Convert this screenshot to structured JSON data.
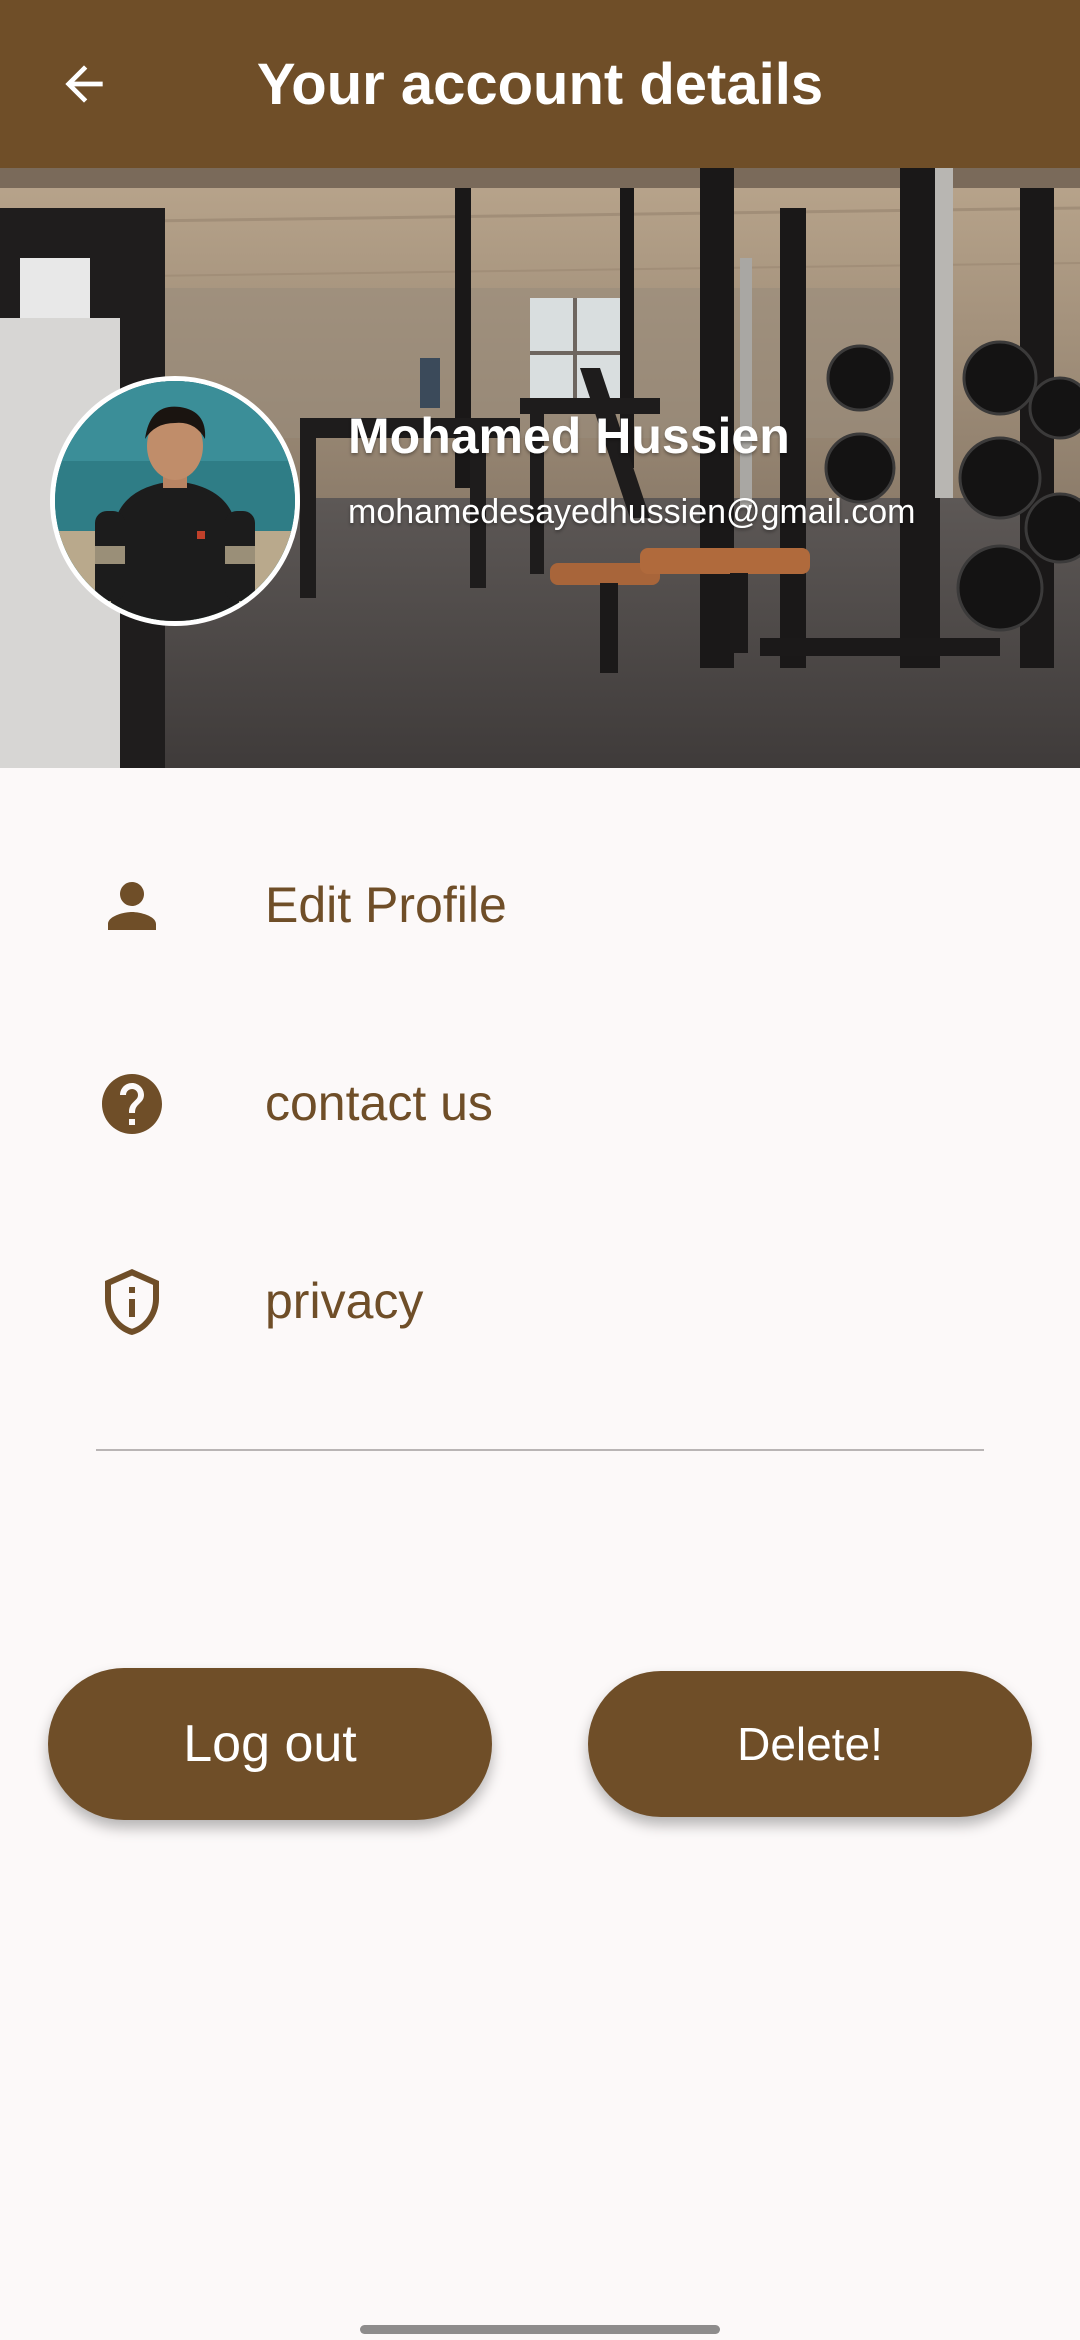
{
  "app_bar": {
    "title": "Your account details",
    "back_icon": "arrow-left-icon",
    "background": "#6f4e28"
  },
  "profile": {
    "name": "Mohamed Hussien",
    "email": "mohamedesayedhussien@gmail.com"
  },
  "menu": [
    {
      "label": "Edit Profile",
      "icon": "person-icon"
    },
    {
      "label": "contact us",
      "icon": "help-circle-icon"
    },
    {
      "label": "privacy",
      "icon": "shield-info-icon"
    }
  ],
  "actions": {
    "logout_label": "Log out",
    "delete_label": "Delete!"
  },
  "colors": {
    "accent": "#6f4e28",
    "page_background": "#fcf9f9",
    "on_accent": "#ffffff"
  }
}
